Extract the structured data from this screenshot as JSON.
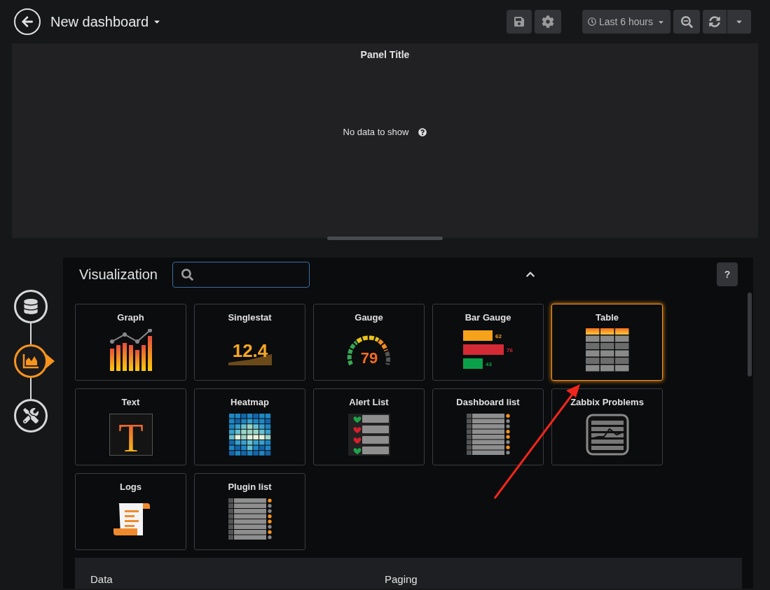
{
  "top_bar": {
    "title": "New dashboard",
    "time_range": "Last 6 hours"
  },
  "panel": {
    "title": "Panel Title",
    "message": "No data to show"
  },
  "steps": [
    {
      "kind": "queries",
      "selected": false
    },
    {
      "kind": "visualization",
      "selected": true
    },
    {
      "kind": "general",
      "selected": false
    }
  ],
  "visualization": {
    "heading": "Visualization",
    "help_label": "?",
    "types": [
      {
        "name": "Graph",
        "kind": "graph",
        "selected": false
      },
      {
        "name": "Singlestat",
        "kind": "singlestat",
        "selected": false,
        "icon_texts": [
          "12.4"
        ]
      },
      {
        "name": "Gauge",
        "kind": "gauge",
        "selected": false,
        "icon_texts": [
          "79"
        ]
      },
      {
        "name": "Bar Gauge",
        "kind": "bargauge",
        "selected": false,
        "icon_texts": [
          "62",
          "76",
          "43"
        ]
      },
      {
        "name": "Table",
        "kind": "table",
        "selected": true
      },
      {
        "name": "Text",
        "kind": "text",
        "selected": false,
        "icon_texts": [
          "T"
        ]
      },
      {
        "name": "Heatmap",
        "kind": "heatmap",
        "selected": false
      },
      {
        "name": "Alert List",
        "kind": "alertlist",
        "selected": false
      },
      {
        "name": "Dashboard list",
        "kind": "dashlist",
        "selected": false
      },
      {
        "name": "Zabbix Problems",
        "kind": "zabbix",
        "selected": false
      },
      {
        "name": "Logs",
        "kind": "logs",
        "selected": false
      },
      {
        "name": "Plugin list",
        "kind": "pluginlist",
        "selected": false
      }
    ]
  },
  "options": {
    "sections": [
      "Data",
      "Paging"
    ]
  }
}
